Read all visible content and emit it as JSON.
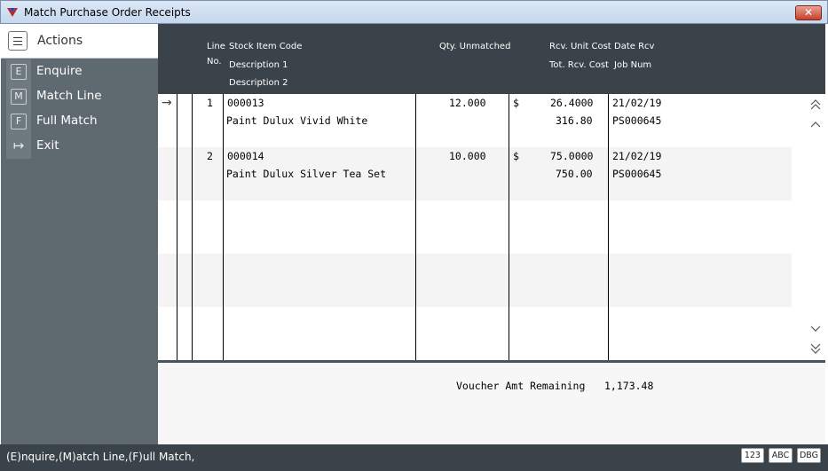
{
  "window": {
    "title": "Match Purchase Order Receipts",
    "close_label": "✕"
  },
  "sidebar": {
    "header": "Actions",
    "actions": [
      {
        "key": "E",
        "label": "Enquire"
      },
      {
        "key": "M",
        "label": "Match Line"
      },
      {
        "key": "F",
        "label": "Full Match"
      },
      {
        "key": "↦",
        "label": "Exit"
      }
    ]
  },
  "grid": {
    "headers": {
      "line": "Line",
      "no": "No.",
      "stock_code": "Stock Item Code",
      "desc1": "Description 1",
      "desc2": "Description 2",
      "qty": "Qty. Unmatched",
      "unit_cost": "Rcv. Unit Cost",
      "tot_cost": "Tot. Rcv. Cost",
      "date": "Date Rcv",
      "job": "Job Num"
    },
    "rows": [
      {
        "line": "1",
        "code": "000013",
        "desc1": "Paint Dulux Vivid White",
        "qty": "12.000",
        "currency": "$",
        "unit_cost": "26.4000",
        "tot_cost": "316.80",
        "date": "21/02/19",
        "job": "PS000645"
      },
      {
        "line": "2",
        "code": "000014",
        "desc1": "Paint Dulux Silver Tea Set",
        "qty": "10.000",
        "currency": "$",
        "unit_cost": "75.0000",
        "tot_cost": "750.00",
        "date": "21/02/19",
        "job": "PS000645"
      }
    ]
  },
  "footer": {
    "voucher_label": "Voucher Amt Remaining",
    "voucher_value": "1,173.48"
  },
  "statusbar": {
    "hint": "(E)nquire,(M)atch Line,(F)ull Match,",
    "indicators": [
      "123",
      "ABC",
      "DBG"
    ]
  },
  "colors": {
    "sidebar": "#5e6970",
    "header": "#3a4349",
    "close": "#c7412a"
  }
}
